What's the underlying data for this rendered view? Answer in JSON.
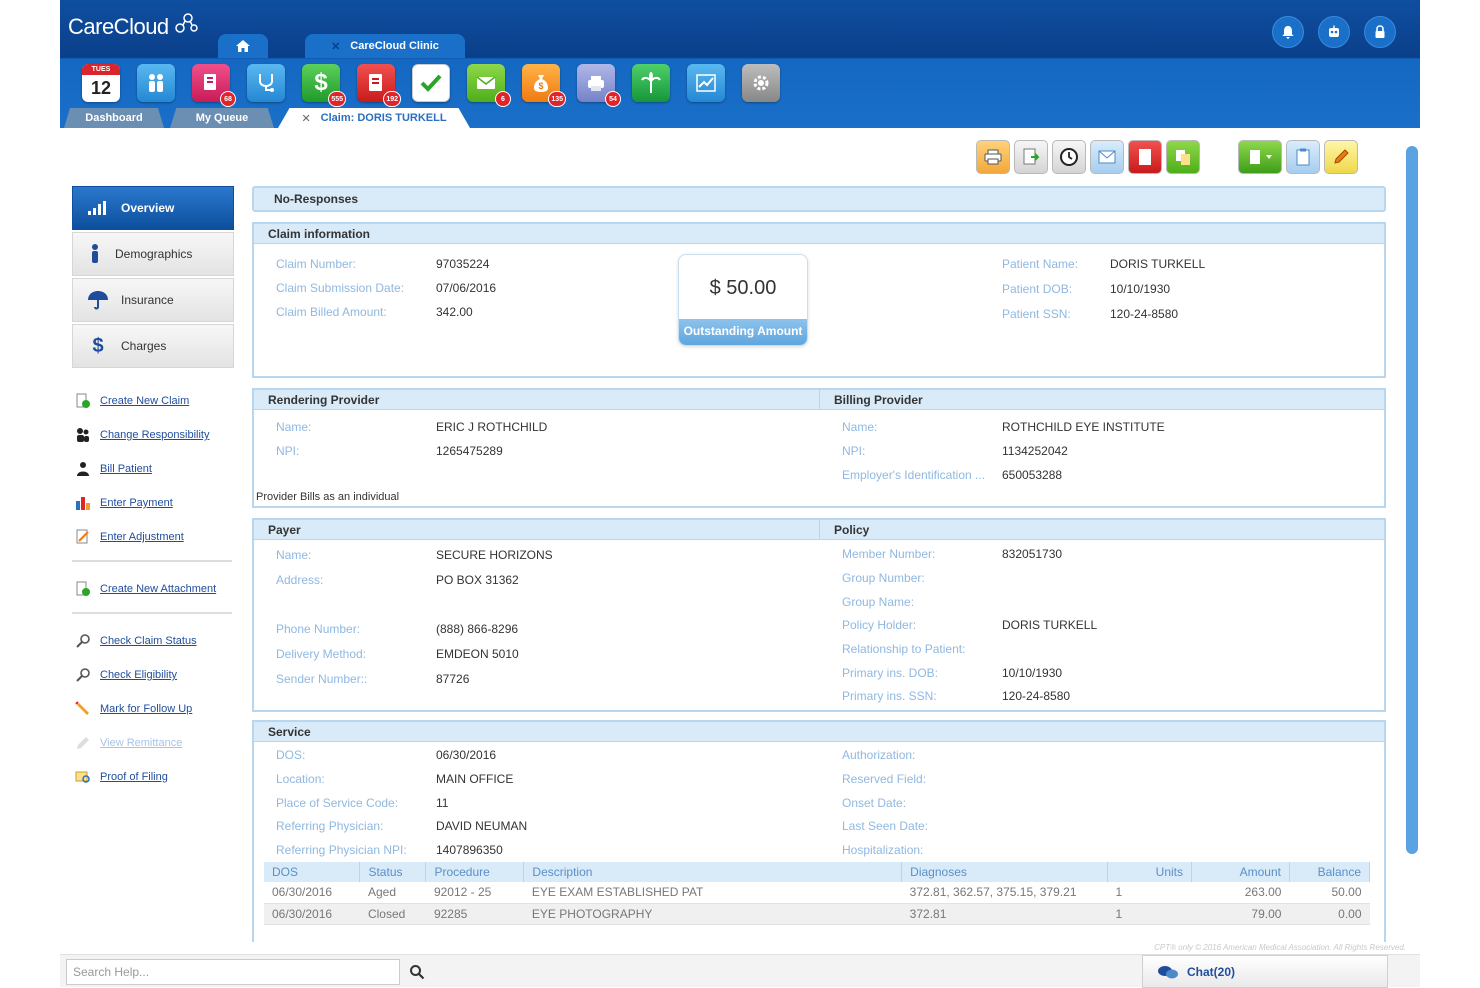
{
  "header": {
    "logo": "CareCloud",
    "tab_clinic": "CareCloud Clinic",
    "tab_close": "✕"
  },
  "app_bar": {
    "calendar_day_name": "TUES",
    "calendar_day": "12",
    "badges": {
      "documents": "68",
      "billing": "555",
      "claims": "192",
      "messages": "6",
      "payments": "135",
      "scanner": "54"
    }
  },
  "sub_tabs": {
    "dashboard": "Dashboard",
    "queue": "My Queue",
    "claim": "Claim: DORIS TURKELL",
    "close": "✕"
  },
  "sidebar": {
    "nav": [
      "Overview",
      "Demographics",
      "Insurance",
      "Charges"
    ],
    "links_group1": [
      "Create New Claim",
      "Change Responsibility",
      "Bill Patient",
      "Enter Payment",
      "Enter Adjustment"
    ],
    "links_group2": [
      "Create New Attachment"
    ],
    "links_group3": [
      "Check Claim Status",
      "Check Eligibility",
      "Mark for Follow Up",
      "View Remittance",
      "Proof of Filing"
    ]
  },
  "main": {
    "no_responses": "No-Responses",
    "claim_info": {
      "title": "Claim information",
      "claim_number_label": "Claim Number:",
      "claim_number": "97035224",
      "submission_date_label": "Claim Submission Date:",
      "submission_date": "07/06/2016",
      "billed_amount_label": "Claim Billed Amount:",
      "billed_amount": "342.00",
      "outstanding_value": "$ 50.00",
      "outstanding_label": "Outstanding Amount",
      "patient_name_label": "Patient Name:",
      "patient_name": "DORIS TURKELL",
      "patient_dob_label": "Patient DOB:",
      "patient_dob": "10/10/1930",
      "patient_ssn_label": "Patient SSN:",
      "patient_ssn": "120-24-8580"
    },
    "rendering": {
      "title": "Rendering Provider",
      "name_label": "Name:",
      "name": "ERIC J ROTHCHILD",
      "npi_label": "NPI:",
      "npi": "1265475289",
      "note": "Provider Bills as an individual"
    },
    "billing": {
      "title": "Billing Provider",
      "name_label": "Name:",
      "name": "ROTHCHILD EYE INSTITUTE",
      "npi_label": "NPI:",
      "npi": "1134252042",
      "ein_label": "Employer's Identification ...",
      "ein": "650053288"
    },
    "payer": {
      "title": "Payer",
      "name_label": "Name:",
      "name": "SECURE HORIZONS",
      "address_label": "Address:",
      "address": "PO BOX 31362",
      "phone_label": "Phone Number:",
      "phone": "(888) 866-8296",
      "delivery_label": "Delivery Method:",
      "delivery": "EMDEON 5010",
      "sender_label": "Sender Number::",
      "sender": "87726"
    },
    "policy": {
      "title": "Policy",
      "member_label": "Member Number:",
      "member": "832051730",
      "group_number_label": "Group Number:",
      "group_name_label": "Group Name:",
      "holder_label": "Policy Holder:",
      "holder": "DORIS TURKELL",
      "relationship_label": "Relationship to Patient:",
      "dob_label": "Primary ins. DOB:",
      "dob": "10/10/1930",
      "ssn_label": "Primary ins. SSN:",
      "ssn": "120-24-8580"
    },
    "service": {
      "title": "Service",
      "dos_label": "DOS:",
      "dos": "06/30/2016",
      "location_label": "Location:",
      "location": "MAIN OFFICE",
      "pos_label": "Place of Service Code:",
      "pos": "11",
      "ref_label": "Referring Physician:",
      "ref": "DAVID  NEUMAN",
      "ref_npi_label": "Referring Physician NPI:",
      "ref_npi": "1407896350",
      "auth_label": "Authorization:",
      "reserved_label": "Reserved Field:",
      "onset_label": "Onset Date:",
      "last_seen_label": "Last Seen Date:",
      "hosp_label": "Hospitalization:",
      "columns": [
        "DOS",
        "Status",
        "Procedure",
        "Description",
        "Diagnoses",
        "Units",
        "Amount",
        "Balance"
      ],
      "rows": [
        [
          "06/30/2016",
          "Aged",
          "92012 - 25",
          "EYE EXAM ESTABLISHED PAT",
          "372.81, 362.57, 375.15, 379.21",
          "1",
          "263.00",
          "50.00"
        ],
        [
          "06/30/2016",
          "Closed",
          "92285",
          "EYE PHOTOGRAPHY",
          "372.81",
          "1",
          "79.00",
          "0.00"
        ]
      ]
    }
  },
  "footer": {
    "search_placeholder": "Search Help...",
    "copyright": "CPT® only © 2016 American Medical Association. All Rights Reserved.",
    "chat": "Chat(20)"
  }
}
